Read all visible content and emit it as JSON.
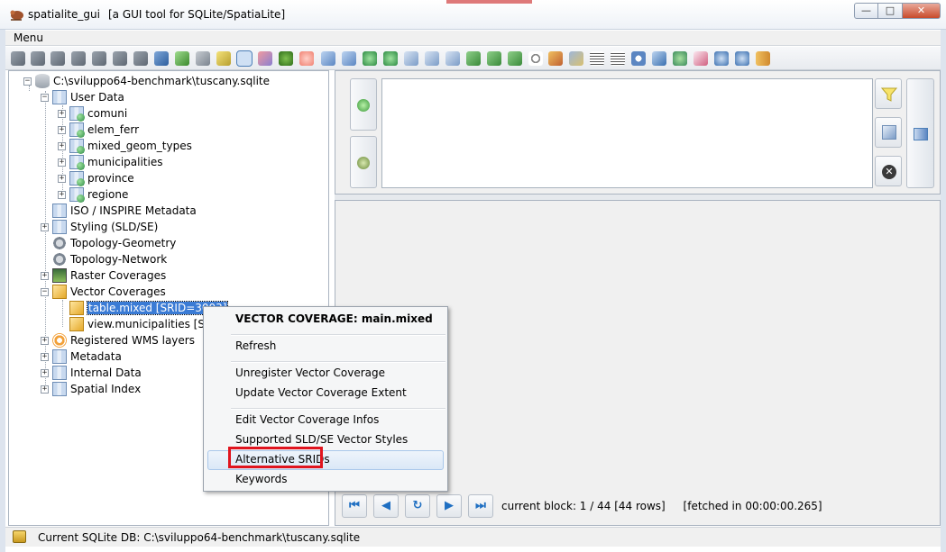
{
  "window": {
    "title": "spatialite_gui",
    "subtitle": "[a GUI tool for SQLite/SpatiaLite]",
    "minimize_glyph": "—",
    "maximize_glyph": "□",
    "close_glyph": "✕"
  },
  "menu": {
    "label": "Menu"
  },
  "tree": {
    "root": "C:\\sviluppo64-benchmark\\tuscany.sqlite",
    "user_data": "User Data",
    "user_tables": [
      "comuni",
      "elem_ferr",
      "mixed_geom_types",
      "municipalities",
      "province",
      "regione"
    ],
    "iso_metadata": "ISO / INSPIRE Metadata",
    "styling": "Styling (SLD/SE)",
    "topology_geometry": "Topology-Geometry",
    "topology_network": "Topology-Network",
    "raster_coverages": "Raster Coverages",
    "vector_coverages": "Vector Coverages",
    "vector_children": [
      "table.mixed [SRID=3003]",
      "view.municipalities [SRI"
    ],
    "wms_layers": "Registered WMS layers",
    "metadata": "Metadata",
    "internal_data": "Internal Data",
    "spatial_index": "Spatial Index"
  },
  "context_menu": {
    "title": "VECTOR COVERAGE: main.mixed",
    "refresh": "Refresh",
    "unregister": "Unregister Vector Coverage",
    "update_extent": "Update Vector Coverage Extent",
    "edit_infos": "Edit Vector Coverage Infos",
    "supported_styles": "Supported SLD/SE Vector Styles",
    "alternative_srids": "Alternative SRIDs",
    "keywords": "Keywords"
  },
  "results": {
    "current_block": "current block: 1 / 44 [44 rows]",
    "fetched": "[fetched in 00:00:00.265]",
    "nav_first": "⏮",
    "nav_prev": "◀",
    "nav_refresh": "↻",
    "nav_next": "▶",
    "nav_last": "⏭"
  },
  "status": {
    "text": "Current SQLite DB: C:\\sviluppo64-benchmark\\tuscany.sqlite"
  },
  "icons": {
    "accent_blue": "#3a7bd5",
    "highlight_red": "#e0141e"
  }
}
